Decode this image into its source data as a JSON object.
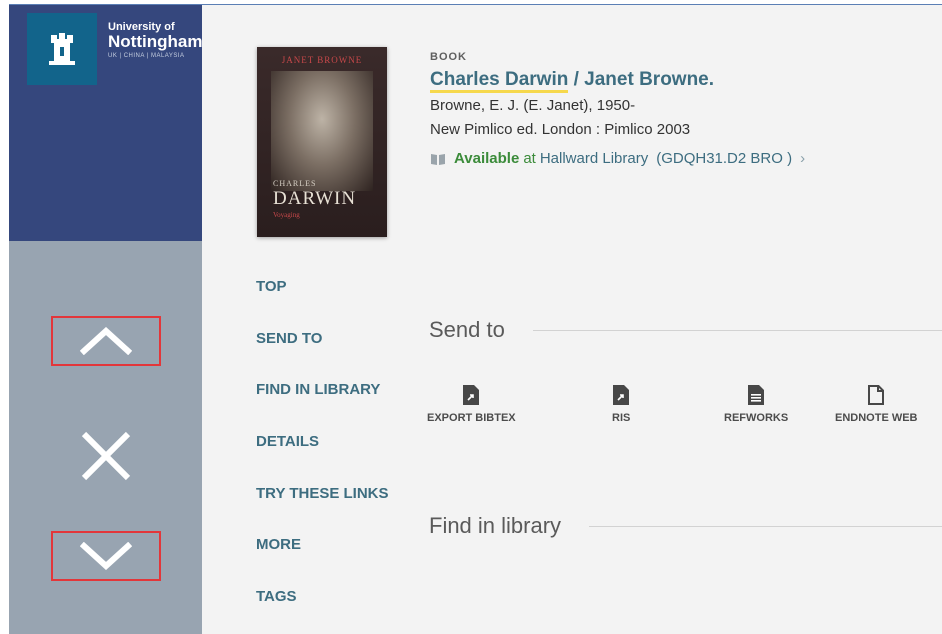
{
  "branding": {
    "line1": "University of",
    "line2": "Nottingham",
    "line3": "UK | CHINA | MALAYSIA"
  },
  "left_rail": {
    "nav_up_icon": "chevron-up-icon",
    "close_icon": "close-icon",
    "nav_down_icon": "chevron-down-icon",
    "highlight_color": "#e3363a"
  },
  "cover": {
    "author": "JANET BROWNE",
    "title_small": "CHARLES",
    "title_big": "DARWIN",
    "subtitle": "Voyaging"
  },
  "record": {
    "type": "BOOK",
    "title_main": "Charles Darwin",
    "title_rest": " / Janet Browne.",
    "author": "Browne, E. J. (E. Janet), 1950-",
    "edition": "New Pimlico ed. London : Pimlico 2003",
    "availability": {
      "status": "Available",
      "at": "at",
      "library": "Hallward Library",
      "call_number": "(GDQH31.D2 BRO )",
      "chevron": "›"
    }
  },
  "section_nav": {
    "items": [
      {
        "label": "TOP"
      },
      {
        "label": "SEND TO"
      },
      {
        "label": "FIND IN LIBRARY"
      },
      {
        "label": "DETAILS"
      },
      {
        "label": "TRY THESE LINKS"
      },
      {
        "label": "MORE"
      },
      {
        "label": "TAGS"
      }
    ]
  },
  "send_to": {
    "heading": "Send to",
    "actions": [
      {
        "label": "EXPORT BIBTEX",
        "icon": "export-file-icon"
      },
      {
        "label": "RIS",
        "icon": "export-file-icon"
      },
      {
        "label": "REFWORKS",
        "icon": "document-icon"
      },
      {
        "label": "ENDNOTE WEB",
        "icon": "blank-file-icon"
      }
    ]
  },
  "find_in_library": {
    "heading": "Find in library"
  },
  "colors": {
    "brand_navy": "#35477d",
    "rail_gray": "#98a4b1",
    "link_teal": "#3d6d80",
    "available_green": "#3b8b3a",
    "title_underline": "#f6d84c"
  }
}
